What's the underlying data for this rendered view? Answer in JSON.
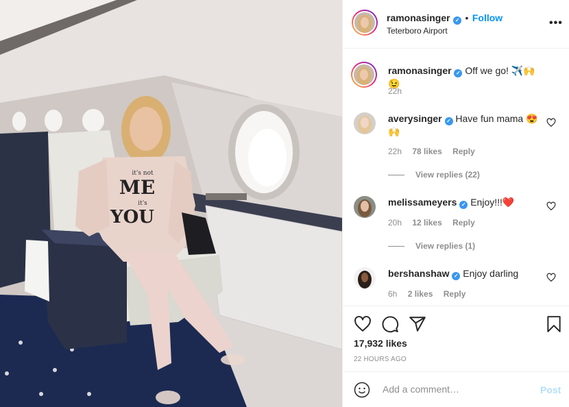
{
  "photo": {
    "shirt_text": [
      "it's not",
      "ME",
      "it's",
      "YOU"
    ]
  },
  "header": {
    "username": "ramonasinger",
    "separator": "•",
    "follow_label": "Follow",
    "location": "Teterboro Airport",
    "more_icon": "more-horizontal-icon"
  },
  "caption": {
    "username": "ramonasinger",
    "text": "Off we go! ✈️🙌😉",
    "time": "22h"
  },
  "comments": [
    {
      "username": "averysinger",
      "text": "Have fun mama 😍🙌",
      "time": "22h",
      "likes": "78 likes",
      "reply": "Reply",
      "view_replies": "View replies (22)"
    },
    {
      "username": "melissameyers",
      "text": "Enjoy!!!❤️",
      "time": "20h",
      "likes": "12 likes",
      "reply": "Reply",
      "view_replies": "View replies (1)"
    },
    {
      "username": "bershanshaw",
      "text": "Enjoy darling",
      "time": "6h",
      "likes": "2 likes",
      "reply": "Reply"
    }
  ],
  "actions": {
    "icons": [
      "heart-icon",
      "comment-icon",
      "share-icon",
      "bookmark-icon"
    ],
    "likes": "17,932 likes",
    "timestamp": "22 HOURS AGO"
  },
  "add_comment": {
    "placeholder": "Add a comment…",
    "post_label": "Post",
    "emoji_icon": "emoji-icon"
  },
  "colors": {
    "link_blue": "#0095f6",
    "verified_blue": "#3897f0",
    "post_disabled": "#b2dffc",
    "heart_red": "#ed4956"
  }
}
